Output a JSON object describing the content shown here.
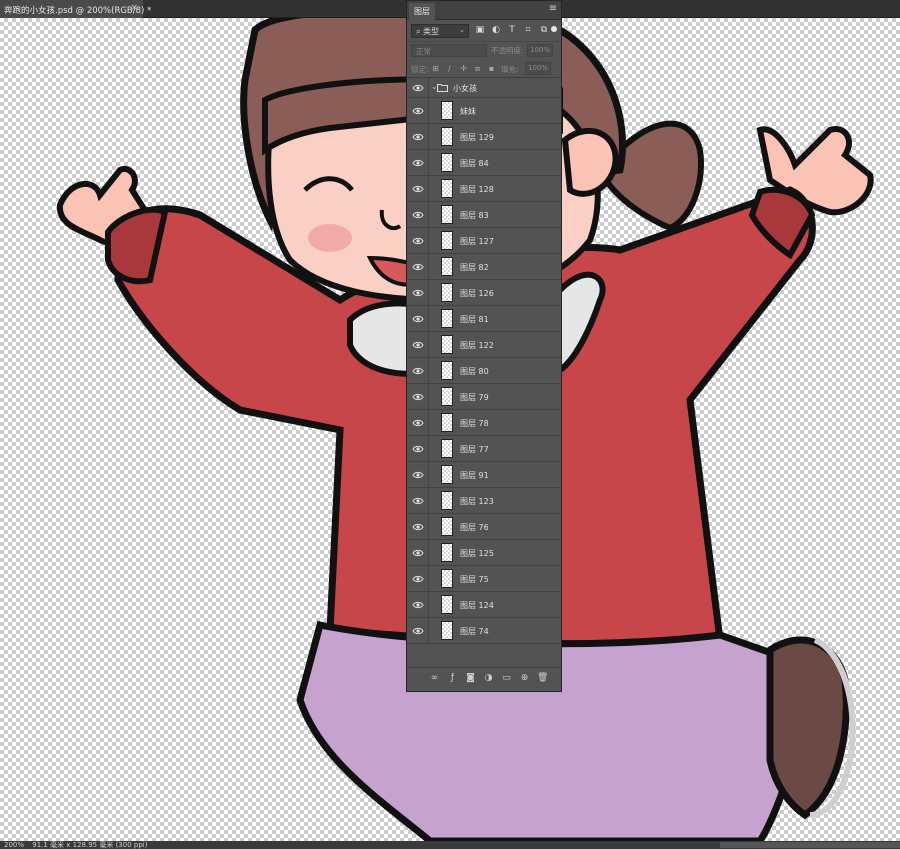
{
  "document": {
    "tab_title": "奔跑的小女孩.psd @ 200%(RGB/8) *",
    "close_glyph": "×"
  },
  "status_bar": {
    "zoom": "200%",
    "doc_info": "91.1 毫米 x 128.95 毫米 (300 ppi)"
  },
  "layers_panel": {
    "tab_label": "图层",
    "menu_icon": "hamburger-menu-icon",
    "filter": {
      "kind_label": "类型",
      "icons": [
        "image-filter-icon",
        "adjustment-filter-icon",
        "type-filter-icon",
        "shape-filter-icon",
        "smart-object-filter-icon"
      ]
    },
    "blend_mode": "正常",
    "opacity_label": "不透明度:",
    "opacity_value": "100%",
    "lock_label": "锁定:",
    "fill_label": "填充:",
    "fill_value": "100%",
    "group": {
      "name": "小女孩",
      "expanded": true
    },
    "layers": [
      {
        "name": "妹妹",
        "visible": true
      },
      {
        "name": "图层 129",
        "visible": true
      },
      {
        "name": "图层 84",
        "visible": true
      },
      {
        "name": "图层 128",
        "visible": true
      },
      {
        "name": "图层 83",
        "visible": true
      },
      {
        "name": "图层 127",
        "visible": true
      },
      {
        "name": "图层 82",
        "visible": true
      },
      {
        "name": "图层 126",
        "visible": true
      },
      {
        "name": "图层 81",
        "visible": true
      },
      {
        "name": "图层 122",
        "visible": true
      },
      {
        "name": "图层 80",
        "visible": true
      },
      {
        "name": "图层 79",
        "visible": true
      },
      {
        "name": "图层 78",
        "visible": true
      },
      {
        "name": "图层 77",
        "visible": true
      },
      {
        "name": "图层 91",
        "visible": true
      },
      {
        "name": "图层 123",
        "visible": true
      },
      {
        "name": "图层 76",
        "visible": true
      },
      {
        "name": "图层 125",
        "visible": true
      },
      {
        "name": "图层 75",
        "visible": true
      },
      {
        "name": "图层 124",
        "visible": true
      },
      {
        "name": "图层 74",
        "visible": true
      }
    ],
    "footer_icons": [
      "link-layers-icon",
      "fx-icon",
      "add-mask-icon",
      "adjustment-layer-icon",
      "new-group-icon",
      "new-layer-icon",
      "delete-layer-icon"
    ]
  },
  "colors": {
    "sweater": "#c7464a",
    "pants": "#c6a3cf",
    "hair": "#8a5e56",
    "skin": "#fbd0c4",
    "shoe": "#6b4a45",
    "panel_bg": "#535353"
  }
}
